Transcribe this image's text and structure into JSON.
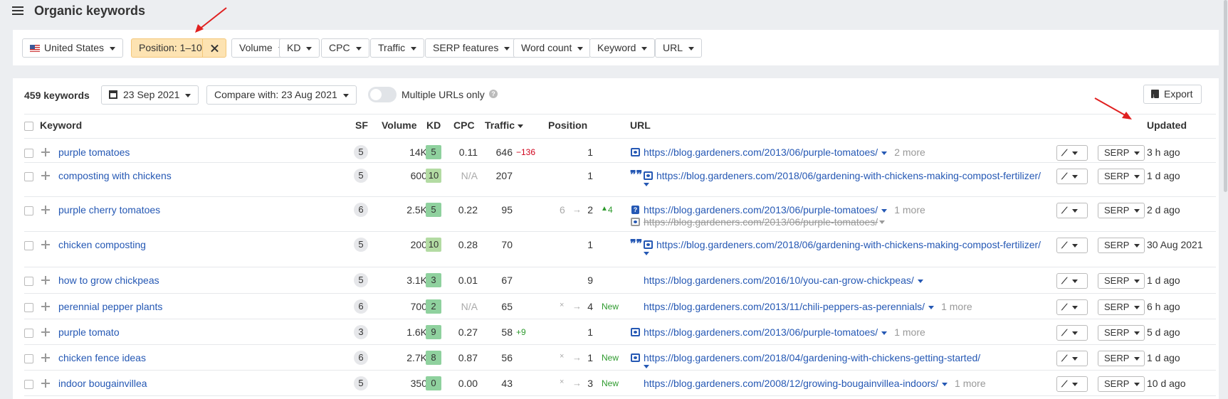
{
  "header": {
    "title": "Organic keywords"
  },
  "filters": {
    "country": "United States",
    "position": "Position: 1–10",
    "volume": "Volume",
    "kd": "KD",
    "cpc": "CPC",
    "traffic": "Traffic",
    "serp_features": "SERP features",
    "word_count": "Word count",
    "keyword": "Keyword",
    "url": "URL"
  },
  "toolbar": {
    "count": "459 keywords",
    "date": "23 Sep 2021",
    "compare": "Compare with: 23 Aug 2021",
    "multiple_urls": "Multiple URLs only",
    "help": "?",
    "export": "Export"
  },
  "columns": {
    "keyword": "Keyword",
    "sf": "SF",
    "volume": "Volume",
    "kd": "KD",
    "cpc": "CPC",
    "traffic": "Traffic",
    "position": "Position",
    "url": "URL",
    "updated": "Updated"
  },
  "buttons": {
    "serp": "SERP"
  },
  "rows": [
    {
      "keyword": "purple tomatoes",
      "sf": "5",
      "volume": "14K",
      "kd": "5",
      "kd_color": "#8fd19e",
      "cpc": "0.11",
      "traffic": "646",
      "traffic_change": "−136",
      "position": "1",
      "url": "https://blog.gardeners.com/2013/06/purple-tomatoes/",
      "more": "2 more",
      "updated": "3 h ago"
    },
    {
      "keyword": "composting with chickens",
      "sf": "5",
      "volume": "600",
      "kd": "10",
      "kd_color": "#b3dba3",
      "cpc": "N/A",
      "traffic": "207",
      "position": "1",
      "url": "https://blog.gardeners.com/2018/06/gardening-with-chickens-making-compost-fertilizer/",
      "updated": "1 d ago"
    },
    {
      "keyword": "purple cherry tomatoes",
      "sf": "6",
      "volume": "2.5K",
      "kd": "5",
      "kd_color": "#8fd19e",
      "cpc": "0.22",
      "traffic": "95",
      "position_from": "6",
      "position": "2",
      "position_change": "4",
      "url": "https://blog.gardeners.com/2013/06/purple-tomatoes/",
      "more": "1 more",
      "url_old": "https://blog.gardeners.com/2013/06/purple-tomatoes/",
      "updated": "2 d ago"
    },
    {
      "keyword": "chicken composting",
      "sf": "5",
      "volume": "200",
      "kd": "10",
      "kd_color": "#b3dba3",
      "cpc": "0.28",
      "traffic": "70",
      "position": "1",
      "url": "https://blog.gardeners.com/2018/06/gardening-with-chickens-making-compost-fertilizer/",
      "updated": "30 Aug 2021"
    },
    {
      "keyword": "how to grow chickpeas",
      "sf": "5",
      "volume": "3.1K",
      "kd": "3",
      "kd_color": "#8fd19e",
      "cpc": "0.01",
      "traffic": "67",
      "position": "9",
      "url": "https://blog.gardeners.com/2016/10/you-can-grow-chickpeas/",
      "updated": "1 d ago"
    },
    {
      "keyword": "perennial pepper plants",
      "sf": "6",
      "volume": "700",
      "kd": "2",
      "kd_color": "#8fd19e",
      "cpc": "N/A",
      "traffic": "65",
      "position_from": "×",
      "position": "4",
      "new": "New",
      "url": "https://blog.gardeners.com/2013/11/chili-peppers-as-perennials/",
      "more": "1 more",
      "updated": "6 h ago"
    },
    {
      "keyword": "purple tomato",
      "sf": "3",
      "volume": "1.6K",
      "kd": "9",
      "kd_color": "#8fd19e",
      "cpc": "0.27",
      "traffic": "58",
      "traffic_change": "+9",
      "position": "1",
      "url": "https://blog.gardeners.com/2013/06/purple-tomatoes/",
      "more": "1 more",
      "updated": "5 d ago"
    },
    {
      "keyword": "chicken fence ideas",
      "sf": "6",
      "volume": "2.7K",
      "kd": "8",
      "kd_color": "#8fd19e",
      "cpc": "0.87",
      "traffic": "56",
      "position_from": "×",
      "position": "1",
      "new": "New",
      "url": "https://blog.gardeners.com/2018/04/gardening-with-chickens-getting-started/",
      "updated": "1 d ago"
    },
    {
      "keyword": "indoor bougainvillea",
      "sf": "5",
      "volume": "350",
      "kd": "0",
      "kd_color": "#8fd19e",
      "cpc": "0.00",
      "traffic": "43",
      "position_from": "×",
      "position": "3",
      "new": "New",
      "url": "https://blog.gardeners.com/2008/12/growing-bougainvillea-indoors/",
      "more": "1 more",
      "updated": "10 d ago"
    }
  ]
}
